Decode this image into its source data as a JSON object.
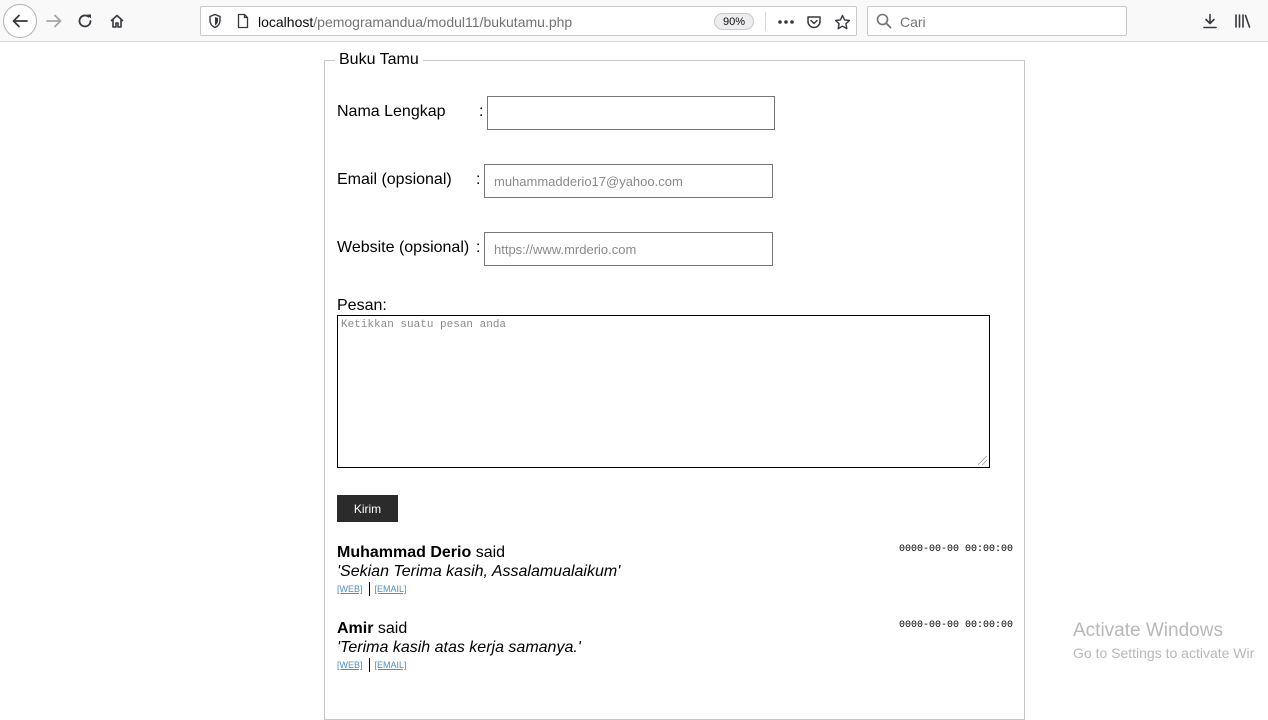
{
  "browser": {
    "url_host": "localhost",
    "url_path": "/pemogramandua/modul11/bukutamu.php",
    "zoom": "90%",
    "search_placeholder": "Cari"
  },
  "form": {
    "legend": "Buku Tamu",
    "name_label": "Nama Lengkap",
    "email_label": "Email (opsional)",
    "website_label": "Website (opsional)",
    "colon": ":",
    "email_placeholder": "muhammadderio17@yahoo.com",
    "website_placeholder": "https://www.mrderio.com",
    "message_label": "Pesan:",
    "message_placeholder": "Ketikkan suatu pesan anda",
    "submit_label": "Kirim"
  },
  "entries": [
    {
      "name": "Muhammad Derio",
      "said": "said",
      "message": "'Sekian Terima kasih, Assalamualaikum'",
      "timestamp": "0000-00-00 00:00:00",
      "web_label": "[WEB]",
      "email_label": "[EMAIL]"
    },
    {
      "name": "Amir",
      "said": "said",
      "message": "'Terima kasih atas kerja samanya.'",
      "timestamp": "0000-00-00 00:00:00",
      "web_label": "[WEB]",
      "email_label": "[EMAIL]"
    }
  ],
  "watermark": {
    "line1": "Activate Windows",
    "line2": "Go to Settings to activate Wir"
  }
}
